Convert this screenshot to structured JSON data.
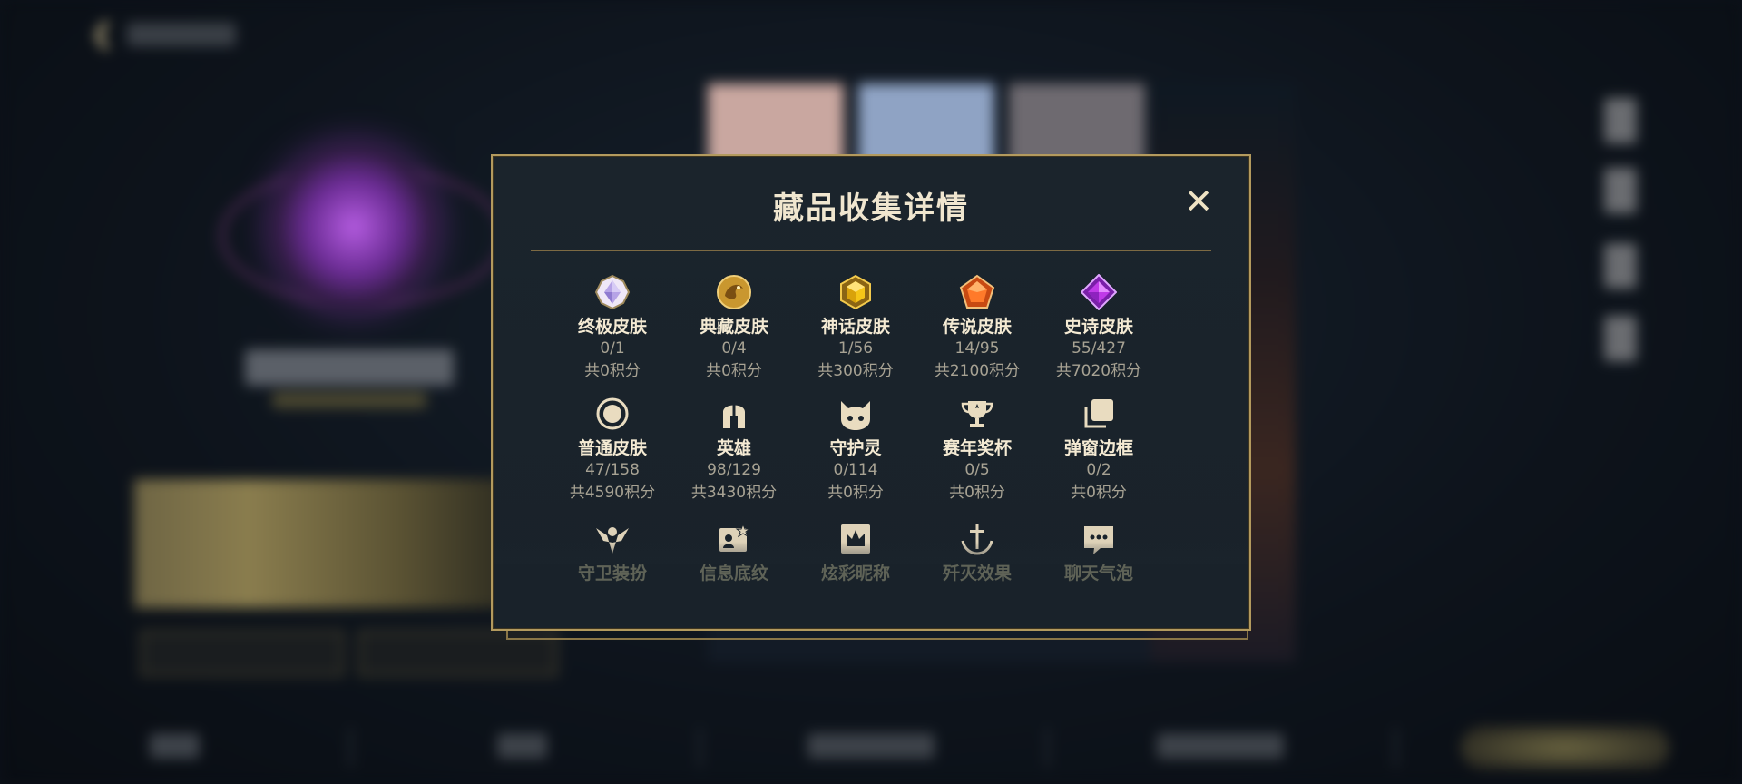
{
  "modal": {
    "title": "藏品收集详情",
    "close": "✕"
  },
  "categories_row1": [
    {
      "label": "终极皮肤",
      "count": "0/1",
      "points": "共0积分",
      "icon": "ultimate-skin-gem-icon"
    },
    {
      "label": "典藏皮肤",
      "count": "0/4",
      "points": "共0积分",
      "icon": "collection-skin-dragon-icon"
    },
    {
      "label": "神话皮肤",
      "count": "1/56",
      "points": "共300积分",
      "icon": "mythic-skin-gem-icon"
    },
    {
      "label": "传说皮肤",
      "count": "14/95",
      "points": "共2100积分",
      "icon": "legendary-skin-gem-icon"
    },
    {
      "label": "史诗皮肤",
      "count": "55/427",
      "points": "共7020积分",
      "icon": "epic-skin-gem-icon"
    }
  ],
  "categories_row2": [
    {
      "label": "普通皮肤",
      "count": "47/158",
      "points": "共4590积分",
      "icon": "normal-skin-circle-icon"
    },
    {
      "label": "英雄",
      "count": "98/129",
      "points": "共3430积分",
      "icon": "hero-helmet-icon"
    },
    {
      "label": "守护灵",
      "count": "0/114",
      "points": "共0积分",
      "icon": "guardian-spirit-icon"
    },
    {
      "label": "赛年奖杯",
      "count": "0/5",
      "points": "共0积分",
      "icon": "season-trophy-icon"
    },
    {
      "label": "弹窗边框",
      "count": "0/2",
      "points": "共0积分",
      "icon": "popup-frame-icon"
    }
  ],
  "categories_row3": [
    {
      "label": "守卫装扮",
      "icon": "guard-outfit-icon"
    },
    {
      "label": "信息底纹",
      "icon": "info-background-icon"
    },
    {
      "label": "炫彩昵称",
      "icon": "colorful-nickname-icon"
    },
    {
      "label": "歼灭效果",
      "icon": "kill-effect-icon"
    },
    {
      "label": "聊天气泡",
      "icon": "chat-bubble-icon"
    }
  ],
  "colors": {
    "gold_border": "#b39a5e",
    "panel_bg": "#1b242c",
    "label_text": "#f4ead3",
    "sub_text": "#a7a293",
    "icon_gold": "#d8c08a"
  }
}
